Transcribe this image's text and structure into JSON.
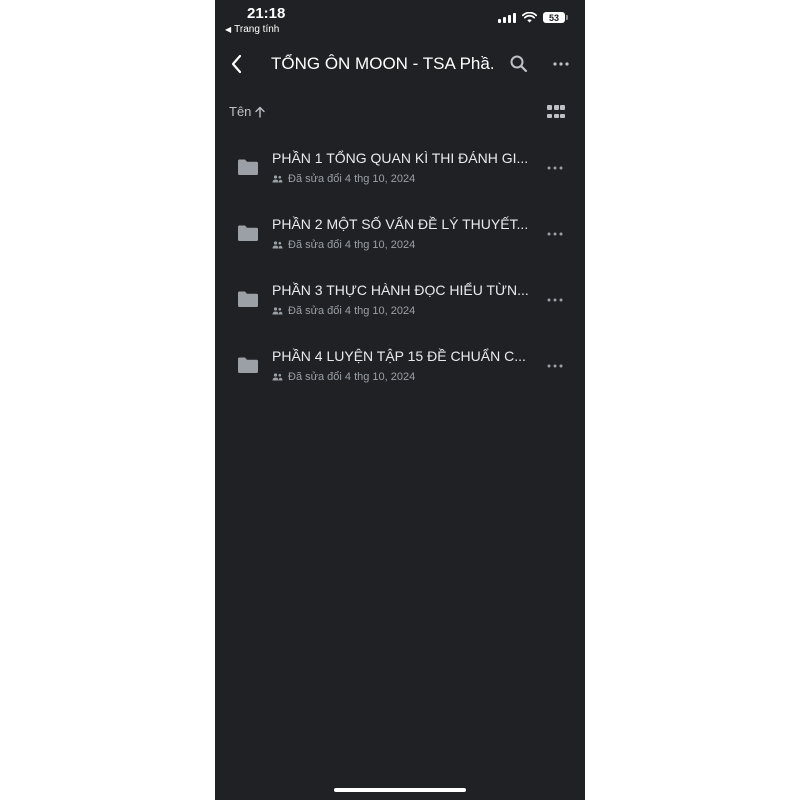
{
  "status_bar": {
    "time": "21:18",
    "back_app_label": "Trang tính",
    "battery": "53"
  },
  "toolbar": {
    "title": "TỔNG ÔN MOON - TSA Phầ..."
  },
  "sort": {
    "label": "Tên"
  },
  "folders": [
    {
      "title": "PHẦN 1 TỔNG QUAN KÌ THI ĐÁNH GI...",
      "meta": "Đã sửa đổi 4 thg 10, 2024"
    },
    {
      "title": "PHẦN 2 MỘT SỐ VẤN ĐỀ LÝ THUYẾT...",
      "meta": "Đã sửa đổi 4 thg 10, 2024"
    },
    {
      "title": "PHẦN 3 THỰC HÀNH ĐỌC HIỂU TỪN...",
      "meta": "Đã sửa đổi 4 thg 10, 2024"
    },
    {
      "title": "PHẦN 4 LUYỆN TẬP 15 ĐỀ CHUẨN C...",
      "meta": "Đã sửa đổi 4 thg 10, 2024"
    }
  ],
  "colors": {
    "background": "#202124",
    "text_primary": "#e8eaed",
    "text_secondary": "#9aa0a6",
    "icon": "#9aa0a6"
  },
  "icons": {
    "back": "chevron-left-icon",
    "search": "search-icon",
    "more": "more-horizontal-icon",
    "sort": "arrow-up-icon",
    "view": "grid-view-icon",
    "folder": "folder-icon",
    "shared": "shared-people-icon"
  }
}
